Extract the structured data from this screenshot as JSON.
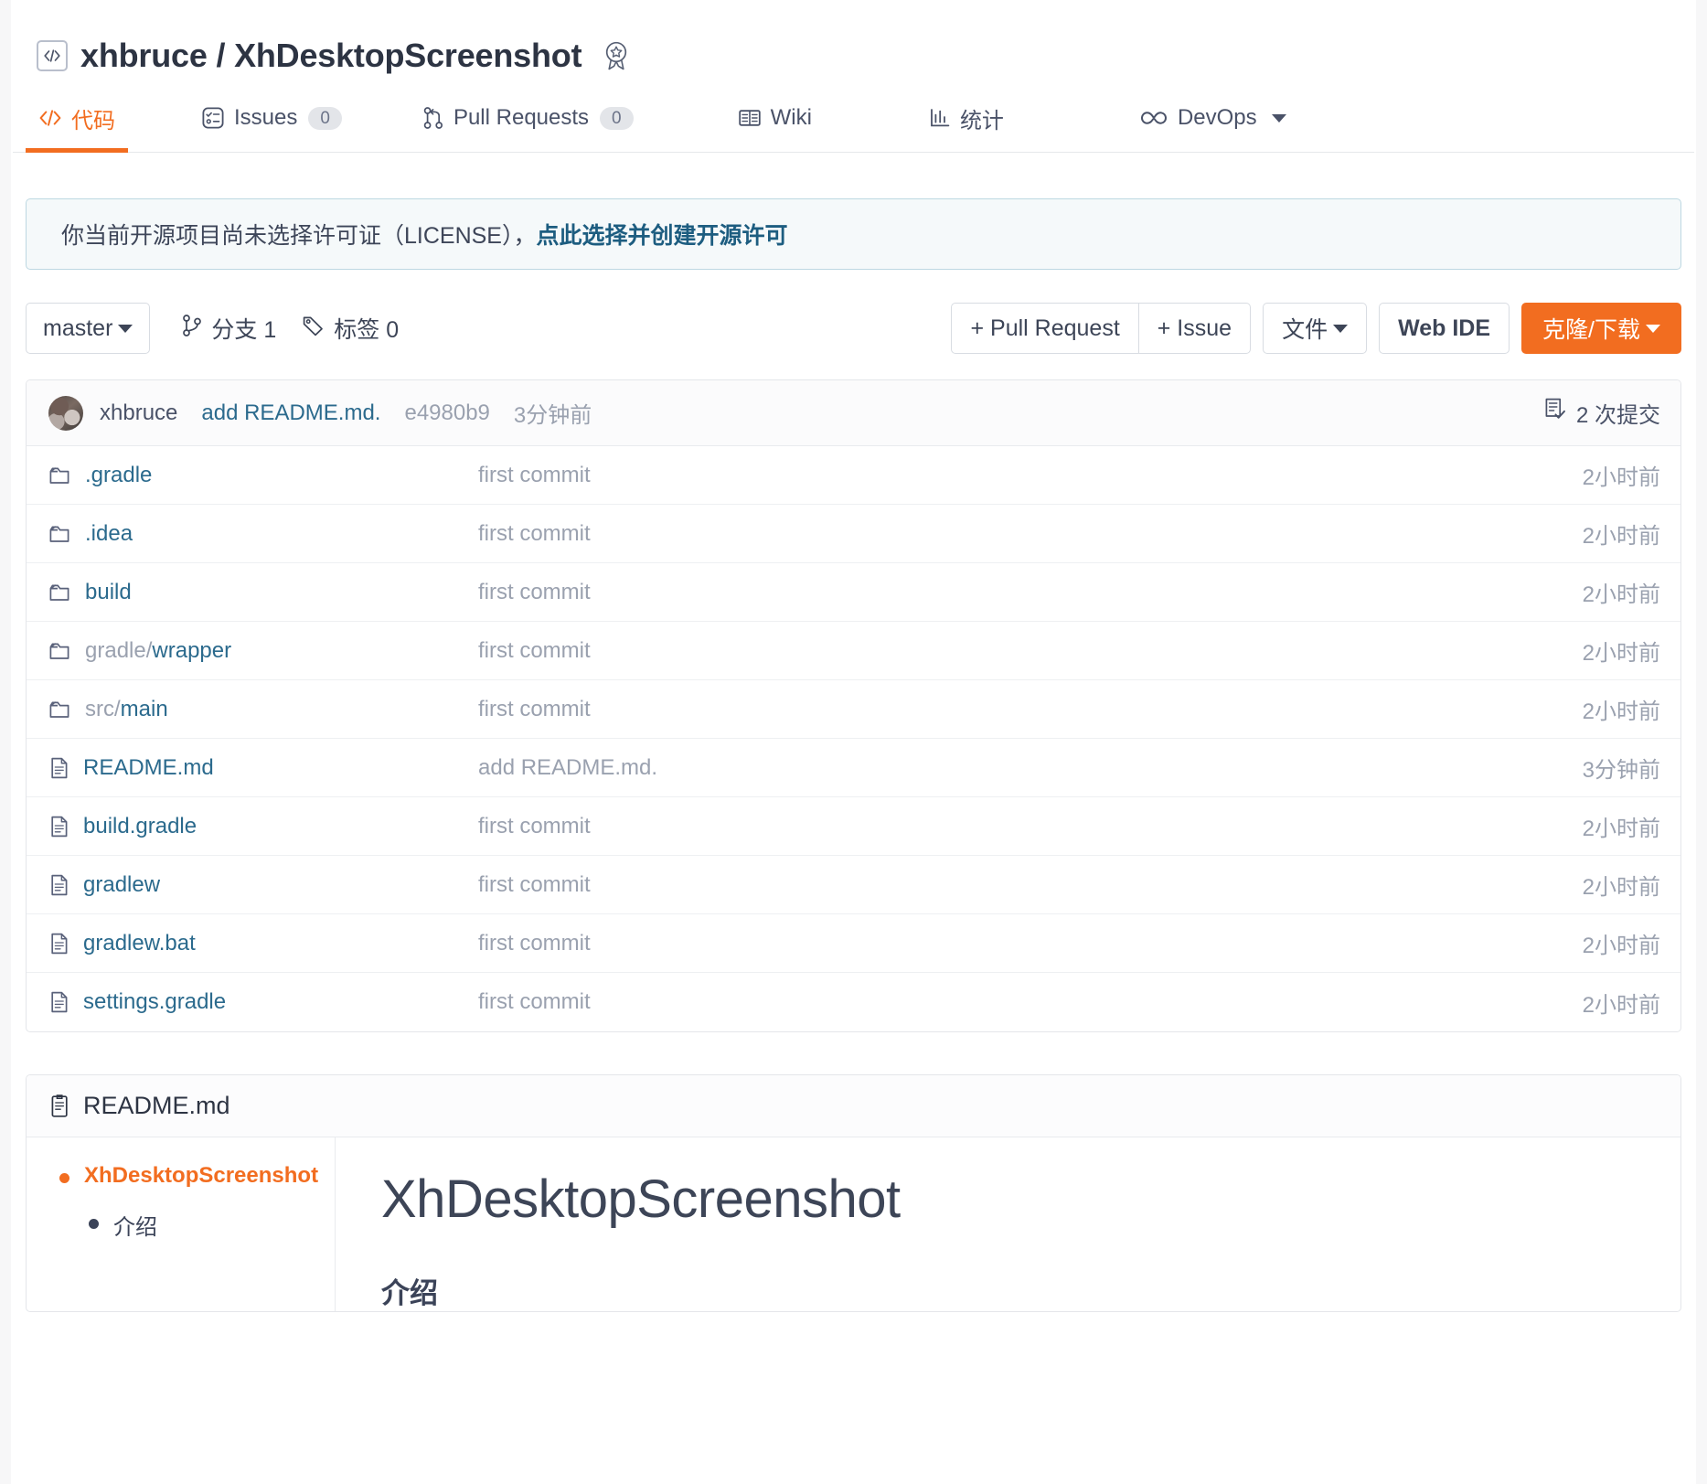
{
  "header": {
    "code_icon": "code-icon",
    "owner": "xhbruce",
    "separator": " / ",
    "repo": "XhDesktopScreenshot",
    "badge_icon": "award-star-icon"
  },
  "nav": {
    "tabs": [
      {
        "label": "代码",
        "icon": "code-brackets-icon",
        "count": null,
        "active": true,
        "dropdown": false
      },
      {
        "label": "Issues",
        "icon": "issue-list-icon",
        "count": "0",
        "active": false,
        "dropdown": false
      },
      {
        "label": "Pull Requests",
        "icon": "pull-request-icon",
        "count": "0",
        "active": false,
        "dropdown": false
      },
      {
        "label": "Wiki",
        "icon": "book-icon",
        "count": null,
        "active": false,
        "dropdown": false
      },
      {
        "label": "统计",
        "icon": "bar-chart-icon",
        "count": null,
        "active": false,
        "dropdown": false
      },
      {
        "label": "DevOps",
        "icon": "infinity-icon",
        "count": null,
        "active": false,
        "dropdown": true
      }
    ]
  },
  "notice": {
    "text": "你当前开源项目尚未选择许可证（LICENSE），",
    "link": "点此选择并创建开源许可"
  },
  "toolbar": {
    "branch": "master",
    "branch_icon": "branch-icon",
    "branches_label": "分支 1",
    "tags_icon": "tag-icon",
    "tags_label": "标签 0",
    "pull_request_button": "+ Pull Request",
    "issue_button": "+ Issue",
    "files_button": "文件",
    "web_ide_button": "Web IDE",
    "clone_button": "克隆/下载"
  },
  "commit_bar": {
    "avatar": "user-avatar",
    "author": "xhbruce",
    "message": "add README.md.",
    "sha": "e4980b9",
    "age": "3分钟前",
    "commits_icon": "commit-history-icon",
    "commits_label": "2 次提交"
  },
  "files": [
    {
      "icon": "folder-icon",
      "prefix": "",
      "name": ".gradle",
      "commit": "first commit",
      "age": "2小时前"
    },
    {
      "icon": "folder-icon",
      "prefix": "",
      "name": ".idea",
      "commit": "first commit",
      "age": "2小时前"
    },
    {
      "icon": "folder-icon",
      "prefix": "",
      "name": "build",
      "commit": "first commit",
      "age": "2小时前"
    },
    {
      "icon": "folder-icon",
      "prefix": "gradle/",
      "name": "wrapper",
      "commit": "first commit",
      "age": "2小时前"
    },
    {
      "icon": "folder-icon",
      "prefix": "src/",
      "name": "main",
      "commit": "first commit",
      "age": "2小时前"
    },
    {
      "icon": "file-icon",
      "prefix": "",
      "name": "README.md",
      "commit": "add README.md.",
      "age": "3分钟前"
    },
    {
      "icon": "file-icon",
      "prefix": "",
      "name": "build.gradle",
      "commit": "first commit",
      "age": "2小时前"
    },
    {
      "icon": "file-icon",
      "prefix": "",
      "name": "gradlew",
      "commit": "first commit",
      "age": "2小时前"
    },
    {
      "icon": "file-icon",
      "prefix": "",
      "name": "gradlew.bat",
      "commit": "first commit",
      "age": "2小时前"
    },
    {
      "icon": "file-icon",
      "prefix": "",
      "name": "settings.gradle",
      "commit": "first commit",
      "age": "2小时前"
    }
  ],
  "readme": {
    "header_icon": "file-icon",
    "header_title": "README.md",
    "toc": [
      {
        "level": 1,
        "label": "XhDesktopScreenshot"
      },
      {
        "level": 2,
        "label": "介绍"
      }
    ],
    "h1": "XhDesktopScreenshot",
    "h2": "介绍"
  },
  "colors": {
    "accent": "#f26d20",
    "link": "#2b6a8d",
    "text": "#3b4358",
    "muted": "#9aa1af",
    "notice_bg": "#f5f9fa",
    "notice_border": "#bdd8e2"
  }
}
